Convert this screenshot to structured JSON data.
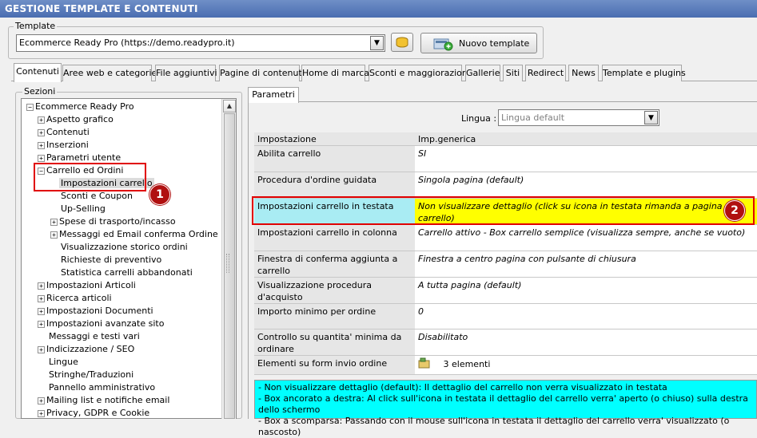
{
  "app": {
    "title": "GESTIONE TEMPLATE E CONTENUTI"
  },
  "template": {
    "group_label": "Template",
    "selected": "Ecommerce Ready Pro (https://demo.readypro.it)",
    "new_button": "Nuovo template"
  },
  "tabs": [
    {
      "label": "Contenuti",
      "active": true
    },
    {
      "label": "Aree web e categorie"
    },
    {
      "label": "File aggiuntivi"
    },
    {
      "label": "Pagine di contenuti"
    },
    {
      "label": "Home di marca"
    },
    {
      "label": "Sconti e maggiorazioni"
    },
    {
      "label": "Gallerie"
    },
    {
      "label": "Siti"
    },
    {
      "label": "Redirect"
    },
    {
      "label": "News"
    },
    {
      "label": "Template e plugins"
    }
  ],
  "sections": {
    "label": "Sezioni",
    "tree": [
      {
        "label": "Ecommerce Ready Pro",
        "expander": "minus"
      },
      {
        "label": "Aspetto grafico",
        "expander": "plus"
      },
      {
        "label": "Contenuti",
        "expander": "plus"
      },
      {
        "label": "Inserzioni",
        "expander": "plus"
      },
      {
        "label": "Parametri utente",
        "expander": "plus"
      },
      {
        "label": "Carrello ed Ordini",
        "expander": "minus"
      },
      {
        "label": "Impostazioni carrello",
        "selected": true
      },
      {
        "label": "Sconti e Coupon"
      },
      {
        "label": "Up-Selling"
      },
      {
        "label": "Spese di trasporto/incasso",
        "expander": "plus"
      },
      {
        "label": "Messaggi ed Email conferma Ordine",
        "expander": "plus"
      },
      {
        "label": "Visualizzazione storico ordini"
      },
      {
        "label": "Richieste di preventivo"
      },
      {
        "label": "Statistica carrelli abbandonati"
      },
      {
        "label": "Impostazioni Articoli",
        "expander": "plus"
      },
      {
        "label": "Ricerca articoli",
        "expander": "plus"
      },
      {
        "label": "Impostazioni Documenti",
        "expander": "plus"
      },
      {
        "label": "Impostazioni avanzate sito",
        "expander": "plus"
      },
      {
        "label": "Messaggi e testi vari"
      },
      {
        "label": "Indicizzazione / SEO",
        "expander": "plus"
      },
      {
        "label": "Lingue"
      },
      {
        "label": "Stringhe/Traduzioni"
      },
      {
        "label": "Pannello amministrativo"
      },
      {
        "label": "Mailing list e notifiche email",
        "expander": "plus"
      },
      {
        "label": "Privacy, GDPR e Cookie",
        "expander": "plus"
      }
    ]
  },
  "params": {
    "tab_label": "Parametri",
    "lingua_label": "Lingua :",
    "lingua_value": "Lingua default",
    "header": {
      "col1": "Impostazione",
      "col2": "Imp.generica"
    },
    "rows": [
      {
        "name": "Abilita carrello",
        "value": "SI"
      },
      {
        "name": "Procedura d'ordine guidata",
        "value": "Singola pagina (default)"
      },
      {
        "name": "Impostazioni carrello in testata",
        "value": "Non visualizzare dettaglio (click su icona in testata rimanda a pagina carrello)"
      },
      {
        "name": "Impostazioni carrello in colonna",
        "value": "Carrello attivo - Box carrello semplice (visualizza sempre, anche se vuoto)"
      },
      {
        "name": "Finestra di conferma aggiunta a carrello",
        "value": "Finestra a centro pagina con pulsante di chiusura"
      },
      {
        "name": "Visualizzazione procedura d'acquisto",
        "value": "A tutta pagina (default)"
      },
      {
        "name": "Importo minimo per ordine",
        "value": "0"
      },
      {
        "name": "Controllo su quantita' minima da ordinare",
        "value": "Disabilitato"
      },
      {
        "name": "Elementi su form invio ordine",
        "value": "3 elementi"
      }
    ],
    "info_lines": [
      "- Non visualizzare dettaglio (default): Il dettaglio del carrello non verra visualizzato in testata",
      "- Box ancorato a destra: Al click sull'icona in testata il dettaglio del carrello verra' aperto (o chiuso) sulla destra dello schermo",
      "- Box a scomparsa: Passando con il mouse sull'icona in testata il dettaglio del carrello verra' visualizzato (o nascosto)"
    ]
  },
  "markers": {
    "one": "1",
    "two": "2"
  },
  "colors": {
    "highlight_name": "#a9ecf3",
    "highlight_value": "#ffff00",
    "info_bg": "#00ffff",
    "annotation": "#e00000"
  }
}
